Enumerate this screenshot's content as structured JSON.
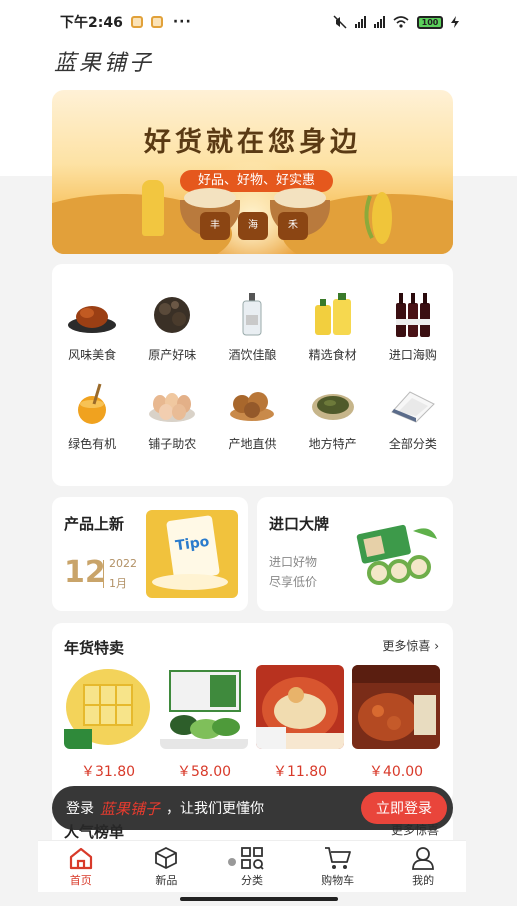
{
  "status_bar": {
    "time": "下午2:46",
    "battery": "100"
  },
  "header": {
    "logo": "蓝果铺子"
  },
  "banner": {
    "title": "好货就在您身边",
    "subtitle": "好品、好物、好实惠",
    "jar_labels": [
      "丰",
      "海",
      "禾"
    ]
  },
  "categories": [
    {
      "label": "风味美食",
      "icon": "roast-duck-icon"
    },
    {
      "label": "原产好味",
      "icon": "mushroom-icon"
    },
    {
      "label": "酒饮佳酿",
      "icon": "liquor-bottle-icon"
    },
    {
      "label": "精选食材",
      "icon": "oil-bottle-icon"
    },
    {
      "label": "进口海购",
      "icon": "wine-bottles-icon"
    },
    {
      "label": "绿色有机",
      "icon": "honey-icon"
    },
    {
      "label": "铺子助农",
      "icon": "eggs-icon"
    },
    {
      "label": "产地直供",
      "icon": "walnut-icon"
    },
    {
      "label": "地方特产",
      "icon": "tea-icon"
    },
    {
      "label": "全部分类",
      "icon": "rice-icon"
    }
  ],
  "promo_left": {
    "title": "产品上新",
    "day": "12",
    "year": "2022",
    "month": "1月",
    "brand_on_bag": "Tipo"
  },
  "promo_right": {
    "title": "进口大牌",
    "line1": "进口好物",
    "line2": "尽享低价"
  },
  "year_goods": {
    "title": "年货特卖",
    "more": "更多惊喜",
    "products": [
      {
        "price": "￥31.80",
        "colors": [
          "#f3d35a",
          "#e6b92d"
        ]
      },
      {
        "price": "￥58.00",
        "colors": [
          "#3f8a3d",
          "#7fbf5a"
        ]
      },
      {
        "price": "￥11.80",
        "colors": [
          "#c8412b",
          "#e8b36a"
        ]
      },
      {
        "price": "￥40.00",
        "colors": [
          "#7a2c18",
          "#c55a2a"
        ]
      }
    ]
  },
  "hot_list": {
    "title": "人气榜单",
    "more": "更多惊喜"
  },
  "login_bar": {
    "prefix": "登录",
    "brand": "蓝果铺子",
    "suffix": "，让我们更懂你",
    "button": "立即登录"
  },
  "tabbar": [
    {
      "label": "首页",
      "icon": "home-icon",
      "active": true
    },
    {
      "label": "新品",
      "icon": "cube-icon",
      "active": false
    },
    {
      "label": "分类",
      "icon": "grid-icon",
      "active": false
    },
    {
      "label": "购物车",
      "icon": "cart-icon",
      "active": false
    },
    {
      "label": "我的",
      "icon": "user-icon",
      "active": false
    }
  ],
  "theme": {
    "accent": "#d83a2a",
    "gold": "#c9a46a"
  }
}
